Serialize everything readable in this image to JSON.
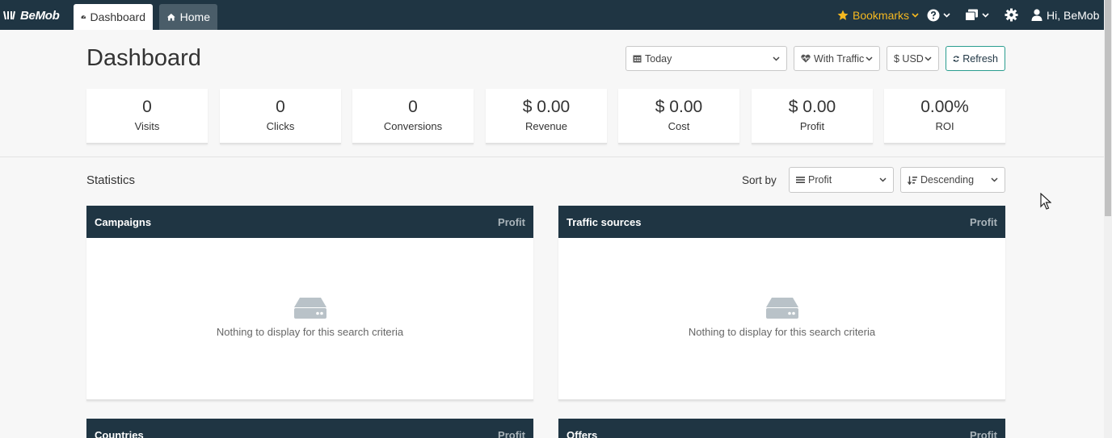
{
  "navbar": {
    "logo_text": "BeMob",
    "tabs": [
      {
        "label": "Dashboard",
        "icon": "gauge-icon",
        "active": true
      },
      {
        "label": "Home",
        "icon": "home-icon",
        "active": false
      }
    ],
    "bookmarks_label": "Bookmarks",
    "user_label": "Hi, BeMob",
    "colors": {
      "bar": "#1f3543",
      "bookmarks": "#f5b820"
    }
  },
  "header": {
    "title": "Dashboard",
    "date_range": "Today",
    "traffic_filter": "With Traffic",
    "currency": "$ USD",
    "refresh_label": "Refresh"
  },
  "stats": [
    {
      "value": "0",
      "label": "Visits"
    },
    {
      "value": "0",
      "label": "Clicks"
    },
    {
      "value": "0",
      "label": "Conversions"
    },
    {
      "value": "$ 0.00",
      "label": "Revenue"
    },
    {
      "value": "$ 0.00",
      "label": "Cost"
    },
    {
      "value": "$ 0.00",
      "label": "Profit"
    },
    {
      "value": "0.00%",
      "label": "ROI"
    }
  ],
  "statistics": {
    "title": "Statistics",
    "sort_by_label": "Sort by",
    "sort_field": "Profit",
    "sort_order": "Descending"
  },
  "panels": [
    {
      "title": "Campaigns",
      "metric": "Profit",
      "empty_message": "Nothing to display for this search criteria"
    },
    {
      "title": "Traffic sources",
      "metric": "Profit",
      "empty_message": "Nothing to display for this search criteria"
    },
    {
      "title": "Countries",
      "metric": "Profit"
    },
    {
      "title": "Offers",
      "metric": "Profit"
    }
  ]
}
